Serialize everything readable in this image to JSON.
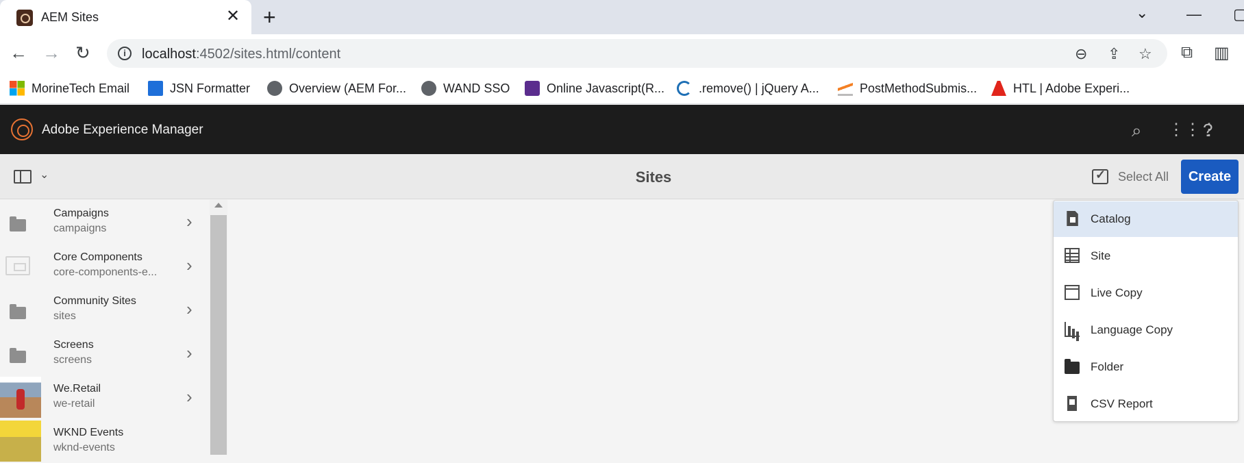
{
  "browser": {
    "tab_title": "AEM Sites",
    "tab_close": "✕",
    "new_tab": "+",
    "window_controls": {
      "dropdown": "⌄",
      "minimize": "—",
      "restore": "▢"
    },
    "url_host": "localhost",
    "url_rest": ":4502/sites.html/content",
    "bookmarks": [
      {
        "label": "MorineTech Email",
        "icon": "microsoft-icon"
      },
      {
        "label": "JSN Formatter",
        "icon": "json-icon"
      },
      {
        "label": "Overview (AEM For...",
        "icon": "globe-icon"
      },
      {
        "label": "WAND SSO",
        "icon": "globe-icon"
      },
      {
        "label": "Online Javascript(R...",
        "icon": "lightning-icon"
      },
      {
        "label": ".remove() | jQuery A...",
        "icon": "jquery-icon"
      },
      {
        "label": "PostMethodSubmis...",
        "icon": "stackoverflow-icon"
      },
      {
        "label": "HTL | Adobe Experi...",
        "icon": "adobe-icon"
      }
    ]
  },
  "aem": {
    "product_name": "Adobe Experience Manager",
    "page_title": "Sites",
    "select_all": "Select All",
    "create": "Create",
    "accent": "#1a5bc0",
    "logo_color": "#e67233"
  },
  "sites": [
    {
      "title": "Campaigns",
      "name": "campaigns",
      "thumb": "folder-icon"
    },
    {
      "title": "Core Components",
      "name": "core-components-e...",
      "thumb": "template-icon"
    },
    {
      "title": "Community Sites",
      "name": "sites",
      "thumb": "folder-icon"
    },
    {
      "title": "Screens",
      "name": "screens",
      "thumb": "folder-icon"
    },
    {
      "title": "We.Retail",
      "name": "we-retail",
      "thumb": "photo"
    },
    {
      "title": "WKND Events",
      "name": "wknd-events",
      "thumb": "photo"
    }
  ],
  "create_menu": [
    {
      "label": "Catalog",
      "icon": "catalog-icon",
      "active": true
    },
    {
      "label": "Site",
      "icon": "site-icon"
    },
    {
      "label": "Live Copy",
      "icon": "live-copy-icon"
    },
    {
      "label": "Language Copy",
      "icon": "language-copy-icon"
    },
    {
      "label": "Folder",
      "icon": "folder-icon"
    },
    {
      "label": "CSV Report",
      "icon": "csv-report-icon"
    }
  ]
}
